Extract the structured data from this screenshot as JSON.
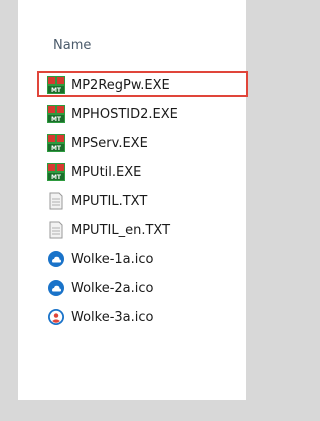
{
  "list": {
    "column_header": "Name",
    "files": [
      {
        "name": "MP2RegPw.EXE",
        "icon": "mt-exe-icon",
        "selected": true
      },
      {
        "name": "MPHOSTID2.EXE",
        "icon": "mt-exe-icon"
      },
      {
        "name": "MPServ.EXE",
        "icon": "mt-exe-icon"
      },
      {
        "name": "MPUtil.EXE",
        "icon": "mt-exe-icon"
      },
      {
        "name": "MPUTIL.TXT",
        "icon": "text-file-icon"
      },
      {
        "name": "MPUTIL_en.TXT",
        "icon": "text-file-icon"
      },
      {
        "name": "Wolke-1a.ico",
        "icon": "cloud-icon"
      },
      {
        "name": "Wolke-2a.ico",
        "icon": "cloud-icon"
      },
      {
        "name": "Wolke-3a.ico",
        "icon": "cloud-user-icon"
      }
    ]
  },
  "colors": {
    "highlight": "#e0453a",
    "exe_green": "#2e9b3f",
    "exe_red": "#d63a2f",
    "cloud_blue": "#1a73c9"
  }
}
